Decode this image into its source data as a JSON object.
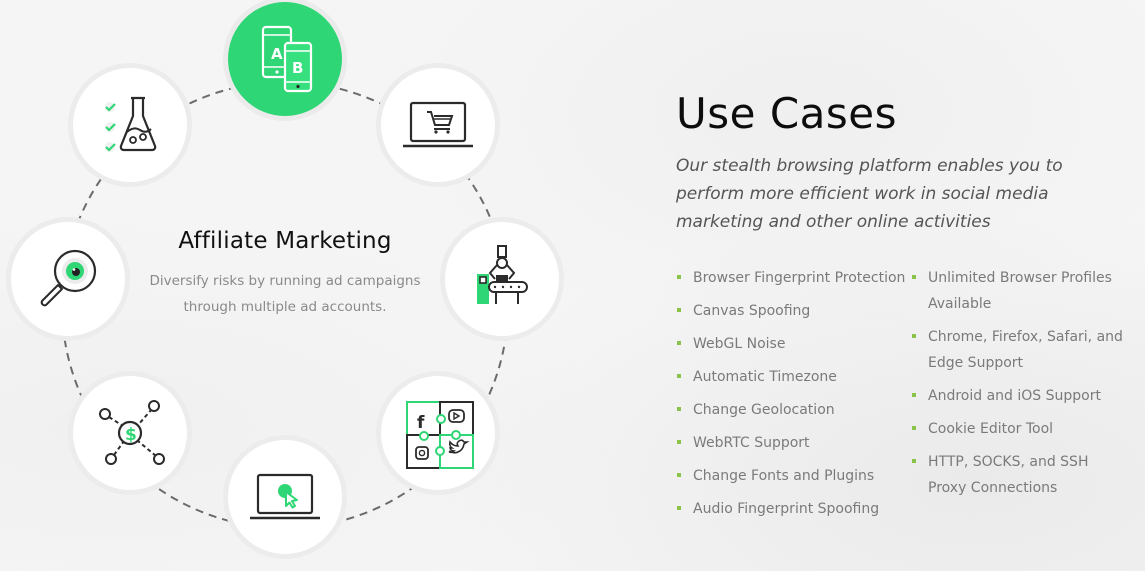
{
  "ring": {
    "active_index": 0,
    "nodes": [
      {
        "id": "ab-testing",
        "icon": "ab-test-phones-icon"
      },
      {
        "id": "ecommerce",
        "icon": "laptop-shopping-cart-icon"
      },
      {
        "id": "automation",
        "icon": "robot-conveyor-icon"
      },
      {
        "id": "social-media",
        "icon": "social-puzzle-icon"
      },
      {
        "id": "traffic-arbitrage",
        "icon": "laptop-click-icon"
      },
      {
        "id": "multi-accounting",
        "icon": "money-network-icon"
      },
      {
        "id": "web-scraping",
        "icon": "magnifier-eye-icon"
      },
      {
        "id": "qa-testing",
        "icon": "flask-checklist-icon"
      }
    ],
    "center": {
      "title": "Affiliate Marketing",
      "description": "Diversify risks by running ad campaigns through multiple ad accounts."
    },
    "ab_letters": [
      "A",
      "B"
    ]
  },
  "use_cases": {
    "title": "Use Cases",
    "subtitle": "Our stealth browsing platform enables you to perform more efficient work in social media marketing and other online activities",
    "column1": [
      "Browser Fingerprint Protection",
      "Canvas Spoofing",
      "WebGL Noise",
      "Automatic Timezone",
      "Change Geolocation",
      "WebRTC Support",
      "Change Fonts and Plugins",
      "Audio Fingerprint Spoofing"
    ],
    "column2": [
      "Unlimited Browser Profiles Available",
      "Chrome, Firefox, Safari, and Edge Support",
      "Android and iOS Support",
      "Cookie Editor Tool",
      "HTTP, SOCKS, and SSH Proxy Connections"
    ]
  },
  "colors": {
    "accent_green": "#2fd675",
    "bullet_green": "#8bc34a",
    "title_dark": "#0d0d0d",
    "body_gray": "#7a7a7a"
  }
}
